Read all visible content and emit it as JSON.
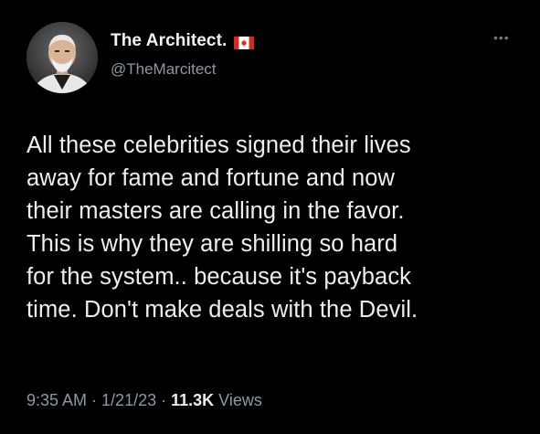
{
  "author": {
    "display_name": "The Architect.",
    "handle": "@TheMarcitect",
    "flag_icon": "canada-flag-icon",
    "avatar_icon": "avatar-photo"
  },
  "more_icon": "more-options-icon",
  "more_glyph": "•••",
  "tweet": {
    "text": "All these celebrities signed their lives\naway for fame and fortune and now\ntheir masters are calling in the favor.\nThis is why they are shilling so hard\nfor the system.. because it's payback\ntime. Don't make deals with the Devil."
  },
  "meta": {
    "time": "9:35 AM",
    "separator": " · ",
    "date": "1/21/23",
    "views_count": "11.3K",
    "views_label": " Views"
  },
  "colors": {
    "background": "#000000",
    "primary_text": "#eceeef",
    "secondary_text": "#8b98a5",
    "flag_red": "#d52b1e"
  }
}
